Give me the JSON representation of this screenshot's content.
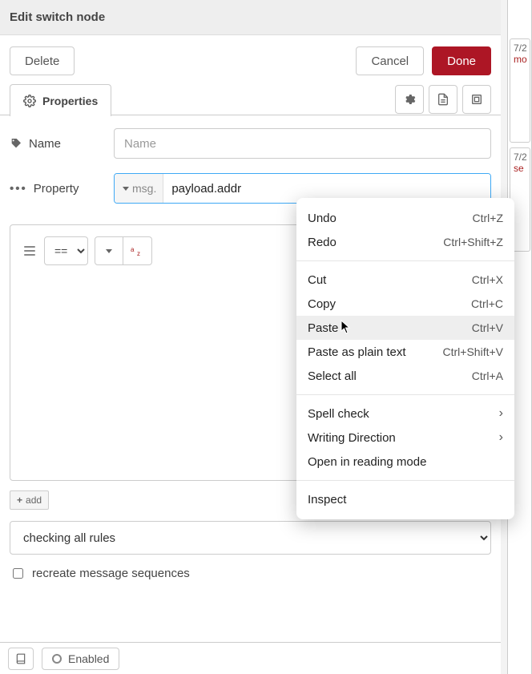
{
  "header": {
    "title": "Edit switch node"
  },
  "buttons": {
    "delete": "Delete",
    "cancel": "Cancel",
    "done": "Done"
  },
  "tabs": {
    "properties": "Properties"
  },
  "form": {
    "name_label": "Name",
    "name_placeholder": "Name",
    "name_value": "",
    "property_label": "Property",
    "property_prefix": "msg.",
    "property_value": "payload.addr"
  },
  "rule": {
    "operator": "=="
  },
  "add_button": "add",
  "checking_mode": "checking all rules",
  "recreate_label": "recreate message sequences",
  "recreate_checked": false,
  "footer": {
    "enabled_label": "Enabled"
  },
  "sidebar": {
    "ts1": "7/2",
    "red1": "mo",
    "ts2": "7/2",
    "red2": "se"
  },
  "context_menu": {
    "undo": {
      "label": "Undo",
      "shortcut": "Ctrl+Z"
    },
    "redo": {
      "label": "Redo",
      "shortcut": "Ctrl+Shift+Z"
    },
    "cut": {
      "label": "Cut",
      "shortcut": "Ctrl+X"
    },
    "copy": {
      "label": "Copy",
      "shortcut": "Ctrl+C"
    },
    "paste": {
      "label": "Paste",
      "shortcut": "Ctrl+V"
    },
    "paste_plain": {
      "label": "Paste as plain text",
      "shortcut": "Ctrl+Shift+V"
    },
    "select_all": {
      "label": "Select all",
      "shortcut": "Ctrl+A"
    },
    "spell_check": "Spell check",
    "writing_direction": "Writing Direction",
    "reading_mode": "Open in reading mode",
    "inspect": "Inspect"
  }
}
